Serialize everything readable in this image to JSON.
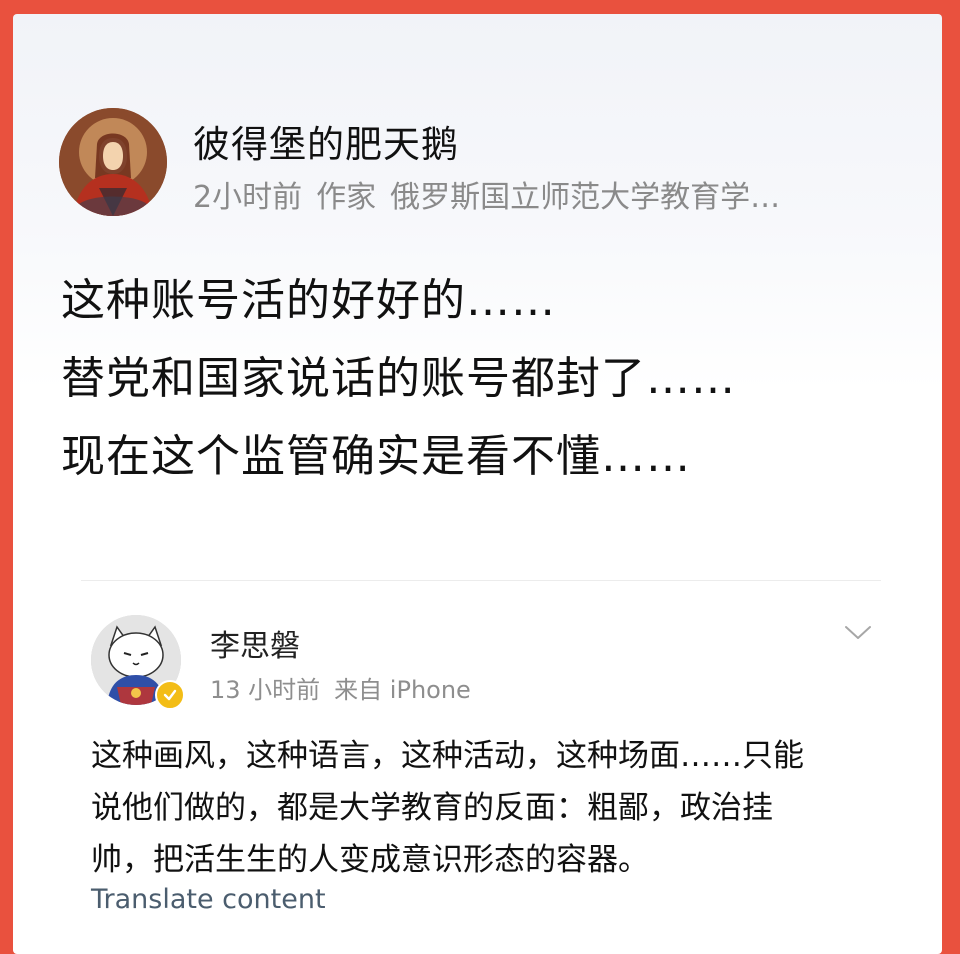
{
  "post": {
    "author": {
      "name": "彼得堡的肥天鹅",
      "meta": [
        "2小时前",
        "作家",
        "俄罗斯国立师范大学教育学…"
      ],
      "avatar": "painted-portrait-avatar"
    },
    "lines": [
      "这种账号活的好好的……",
      "替党和国家说话的账号都封了……",
      "现在这个监管确实是看不懂……"
    ]
  },
  "comment": {
    "author": {
      "name": "李思磐",
      "time": "13 小时前",
      "source": "来自 iPhone",
      "avatar": "cat-illustration-avatar",
      "verified": true
    },
    "lines": [
      "这种画风，这种语言，这种活动，这种场面……只能",
      "说他们做的，都是大学教育的反面：粗鄙，政治挂",
      "帅，把活生生的人变成意识形态的容器。"
    ],
    "translate_label": "Translate content"
  },
  "colors": {
    "border": "#e9513e",
    "verified": "#f3bd16",
    "link": "#4b5d6e"
  }
}
